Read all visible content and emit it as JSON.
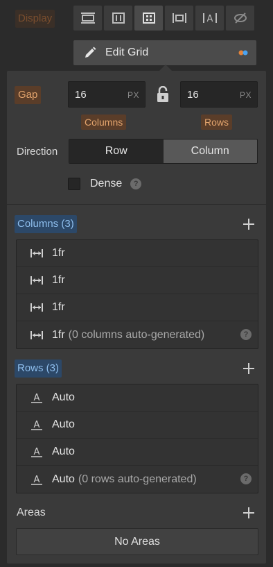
{
  "display": {
    "label": "Display",
    "modes": [
      {
        "icon": "display-block-icon"
      },
      {
        "icon": "display-flex-icon"
      },
      {
        "icon": "display-grid-icon",
        "active": true
      },
      {
        "icon": "display-inline-block-icon"
      },
      {
        "icon": "display-inline-icon"
      },
      {
        "icon": "display-none-icon"
      }
    ]
  },
  "edit_grid": {
    "label": "Edit Grid",
    "icon": "pencil-icon",
    "indicator_colors": [
      "#e3833b",
      "#4aa3f0"
    ]
  },
  "gap": {
    "label": "Gap",
    "columns_value": "16",
    "columns_unit": "PX",
    "rows_value": "16",
    "rows_unit": "PX",
    "columns_label": "Columns",
    "rows_label": "Rows",
    "lock_icon": "unlock-icon"
  },
  "direction": {
    "label": "Direction",
    "options": [
      "Row",
      "Column"
    ],
    "selected": "Row"
  },
  "dense": {
    "label": "Dense",
    "checked": false,
    "help": "?"
  },
  "columns": {
    "title": "Columns (3)",
    "items": [
      {
        "value": "1fr",
        "note": ""
      },
      {
        "value": "1fr",
        "note": ""
      },
      {
        "value": "1fr",
        "note": ""
      },
      {
        "value": "1fr",
        "note": "(0 columns auto-generated)"
      }
    ],
    "help": "?"
  },
  "rows": {
    "title": "Rows (3)",
    "items": [
      {
        "value": "Auto",
        "note": ""
      },
      {
        "value": "Auto",
        "note": ""
      },
      {
        "value": "Auto",
        "note": ""
      },
      {
        "value": "Auto",
        "note": "(0 rows auto-generated)"
      }
    ],
    "help": "?"
  },
  "areas": {
    "label": "Areas",
    "empty_text": "No Areas"
  },
  "colors": {
    "accent_orange": "#e3a46d",
    "accent_blue": "#8fbfee",
    "panel": "#3a3a3a",
    "background": "#2b2b2b"
  }
}
